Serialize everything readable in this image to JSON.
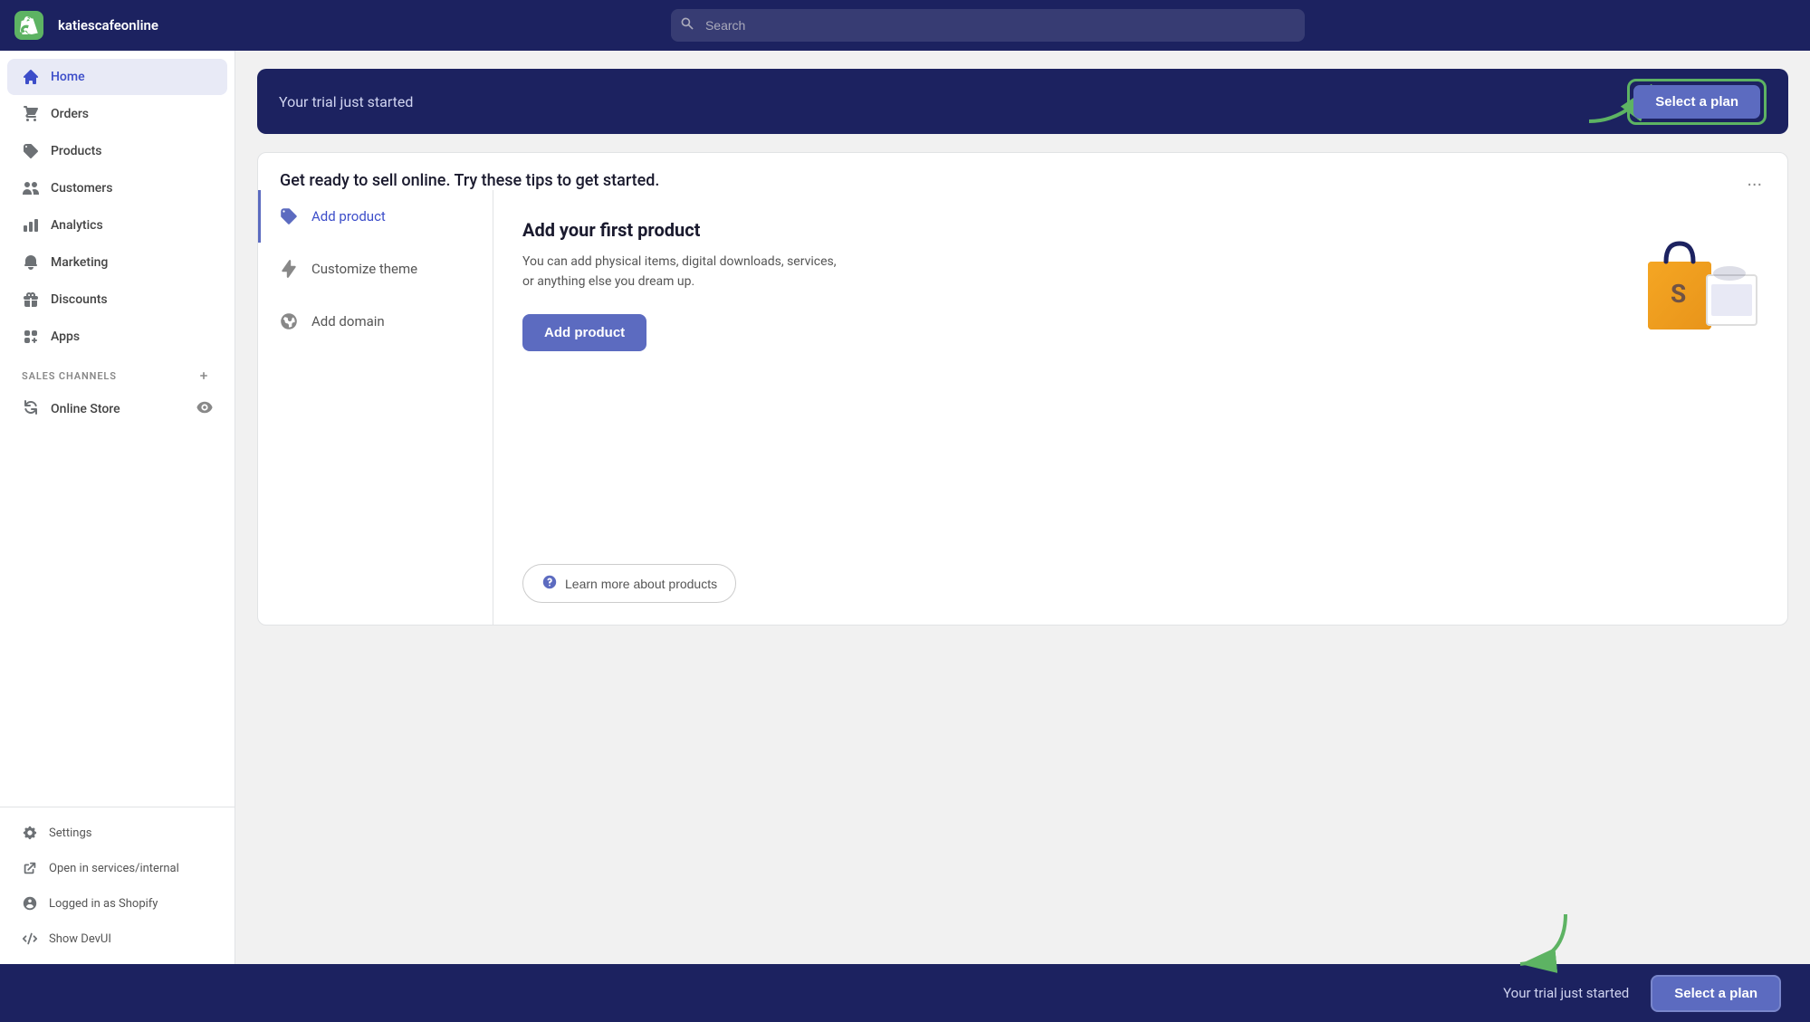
{
  "app": {
    "store_name": "katiescafeonline"
  },
  "topnav": {
    "search_placeholder": "Search"
  },
  "sidebar": {
    "items": [
      {
        "id": "home",
        "label": "Home",
        "active": true
      },
      {
        "id": "orders",
        "label": "Orders",
        "active": false
      },
      {
        "id": "products",
        "label": "Products",
        "active": false
      },
      {
        "id": "customers",
        "label": "Customers",
        "active": false
      },
      {
        "id": "analytics",
        "label": "Analytics",
        "active": false
      },
      {
        "id": "marketing",
        "label": "Marketing",
        "active": false
      },
      {
        "id": "discounts",
        "label": "Discounts",
        "active": false
      },
      {
        "id": "apps",
        "label": "Apps",
        "active": false
      }
    ],
    "sales_channels_label": "SALES CHANNELS",
    "online_store_label": "Online Store",
    "bottom_items": [
      {
        "id": "settings",
        "label": "Settings"
      },
      {
        "id": "open-internal",
        "label": "Open in services/internal"
      },
      {
        "id": "logged-in",
        "label": "Logged in as Shopify"
      },
      {
        "id": "show-devui",
        "label": "Show DevUI"
      }
    ]
  },
  "trial_banner": {
    "text": "Your trial just started",
    "button_label": "Select a plan"
  },
  "tips_card": {
    "title": "Get ready to sell online. Try these tips to get started.",
    "steps": [
      {
        "id": "add-product",
        "label": "Add product",
        "active": true
      },
      {
        "id": "customize-theme",
        "label": "Customize theme",
        "active": false
      },
      {
        "id": "add-domain",
        "label": "Add domain",
        "active": false
      }
    ],
    "active_step": {
      "title": "Add your first product",
      "description": "You can add physical items, digital downloads, services, or anything else you dream up.",
      "action_label": "Add product",
      "learn_label": "Learn more about products"
    },
    "more_options": "..."
  },
  "bottom_bar": {
    "text": "Your trial just started",
    "button_label": "Select a plan"
  }
}
